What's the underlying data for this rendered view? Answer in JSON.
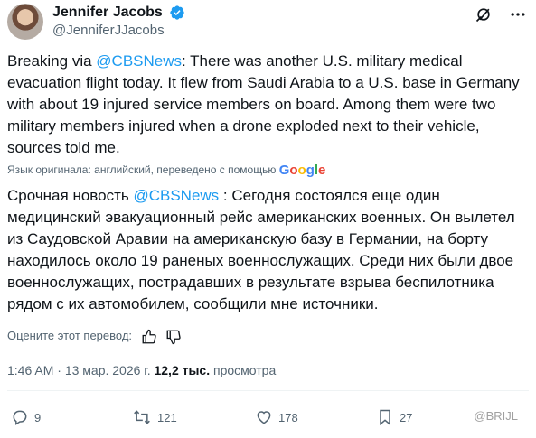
{
  "author": {
    "display_name": "Jennifer Jacobs",
    "handle": "@JenniferJJacobs"
  },
  "tweet": {
    "text_1": "Breaking via ",
    "mention": "@CBSNews",
    "text_2": ": There was another U.S. military medical evacuation flight today. It flew from Saudi Arabia to a U.S. base in Germany with about 19 injured service members on board. Among them were two military members injured when a drone exploded next to their vehicle, sources told me."
  },
  "translation_note": {
    "label": "Язык оригинала: английский, переведено с помощью",
    "brand": "Google"
  },
  "translation": {
    "text_1": "Срочная новость ",
    "mention": "@CBSNews",
    "text_2": " : Сегодня состоялся еще один медицинский эвакуационный рейс американских военных. Он вылетел из Саудовской Аравии на американскую базу в Германии, на борту находилось около 19 раненых военнослужащих. Среди них были двое военнослужащих, пострадавших в результате взрыва беспилотника рядом с их автомобилем, сообщили мне источники."
  },
  "rate_translation": {
    "label": "Оцените этот перевод:"
  },
  "meta": {
    "time": "1:46 AM",
    "sep": " · ",
    "date": "13 мар. 2026 г.",
    "views_count": "12,2 тыс.",
    "views_label": " просмотра"
  },
  "actions": {
    "replies": "9",
    "reposts": "121",
    "likes": "178",
    "bookmarks": "27"
  },
  "watermark": "@BRIJL",
  "colors": {
    "accent": "#1d9bf0",
    "text": "#0f1419",
    "muted": "#536471"
  }
}
